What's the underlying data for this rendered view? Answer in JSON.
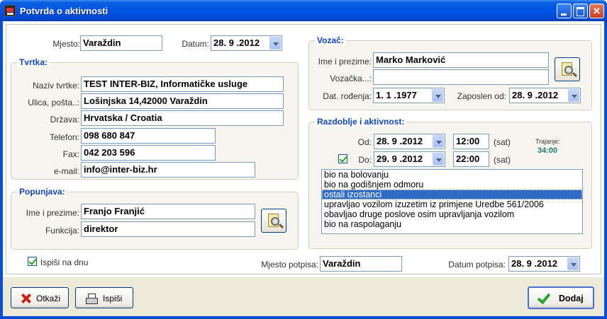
{
  "window": {
    "title": "Potvrda o aktivnosti"
  },
  "top": {
    "mjesto_label": "Mjesto:",
    "mjesto_value": "Varaždin",
    "datum_label": "Datum:",
    "datum_value": "28. 9 .2012"
  },
  "tvrtka": {
    "title": "Tvrtka:",
    "naziv_label": "Naziv tvrtke:",
    "naziv_value": "TEST INTER-BIZ, Informatičke usluge",
    "ulica_label": "Ulica, pošta..:",
    "ulica_value": "Lošinjska 14,42000 Varaždin",
    "drzava_label": "Država:",
    "drzava_value": "Hrvatska / Croatia",
    "telefon_label": "Telefon:",
    "telefon_value": "098 680 847",
    "fax_label": "Fax:",
    "fax_value": "042 203 596",
    "email_label": "e-mail:",
    "email_value": "info@inter-biz.hr"
  },
  "popunjava": {
    "title": "Popunjava:",
    "ime_label": "Ime i prezime:",
    "ime_value": "Franjo Franjić",
    "funkcija_label": "Funkcija:",
    "funkcija_value": "direktor"
  },
  "vozac": {
    "title": "Vozač:",
    "ime_label": "Ime i prezime:",
    "ime_value": "Marko Marković",
    "vozacka_label": "Vozačka...:",
    "vozacka_value": "",
    "dat_rodenja_label": "Dat. rođenja:",
    "dat_rodenja_value": "1. 1 .1977",
    "zaposlen_label": "Zaposlen od:",
    "zaposlen_value": "28. 9 .2012"
  },
  "razdoblje": {
    "title": "Razdoblje i aktivnost:",
    "od_label": "Od:",
    "od_date": "28. 9 .2012",
    "od_time": "12:00",
    "od_unit": "(sat)",
    "do_label": "Do:",
    "do_date": "29. 9 .2012",
    "do_time": "22:00",
    "do_unit": "(sat)",
    "do_checked": true,
    "trajanje_label": "Trajanje:",
    "trajanje_value": "34:00",
    "activities": [
      "bio na bolovanju",
      "bio na godišnjem odmoru",
      "ostali izostanci",
      "upravljao vozilom izuzetim iz primjene Uredbe 561/2006",
      "obavljao druge poslove osim upravljanja vozilom",
      "bio na raspolaganju"
    ],
    "selected_index": 2
  },
  "footer": {
    "ispisi_na_dnu_label": "Ispiši na dnu",
    "ispisi_na_dnu_checked": true,
    "mjesto_potpisa_label": "Mjesto potpisa:",
    "mjesto_potpisa_value": "Varaždin",
    "datum_potpisa_label": "Datum potpisa:",
    "datum_potpisa_value": "28. 9 .2012"
  },
  "buttons": {
    "otkazi": "Otkaži",
    "ispisi": "Ispiši",
    "dodaj": "Dodaj"
  }
}
